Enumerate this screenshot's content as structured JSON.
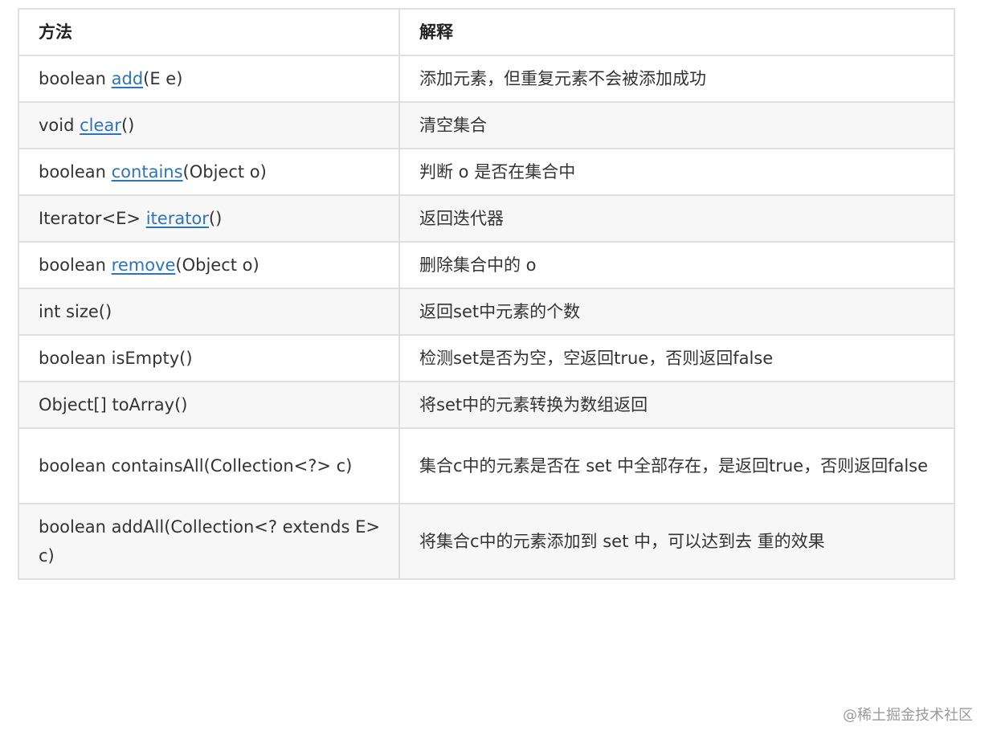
{
  "table": {
    "headers": [
      "方法",
      "解释"
    ],
    "rows": [
      {
        "method_prefix": "boolean ",
        "method_link": "add",
        "method_suffix": "(E e)",
        "description": "添加元素，但重复元素不会被添加成功"
      },
      {
        "method_prefix": "void ",
        "method_link": "clear",
        "method_suffix": "()",
        "description": "清空集合"
      },
      {
        "method_prefix": "boolean ",
        "method_link": "contains",
        "method_suffix": "(Object o)",
        "description": "判断 o 是否在集合中"
      },
      {
        "method_prefix": "Iterator<E> ",
        "method_link": "iterator",
        "method_suffix": "()",
        "description": "返回迭代器"
      },
      {
        "method_prefix": "boolean ",
        "method_link": "remove",
        "method_suffix": "(Object o)",
        "description": "删除集合中的 o"
      },
      {
        "method": "int size()",
        "description": "返回set中元素的个数"
      },
      {
        "method": "boolean isEmpty()",
        "description": "检测set是否为空，空返回true，否则返回false"
      },
      {
        "method": "Object[] toArray()",
        "description": "将set中的元素转换为数组返回"
      },
      {
        "method": "boolean containsAll(Collection<?> c)",
        "description": "集合c中的元素是否在 set 中全部存在，是返回true，否则返回false"
      },
      {
        "method": "boolean addAll(Collection<? extends E> c)",
        "description": "将集合c中的元素添加到 set 中，可以达到去 重的效果"
      }
    ]
  },
  "watermark": "@稀土掘金技术社区"
}
